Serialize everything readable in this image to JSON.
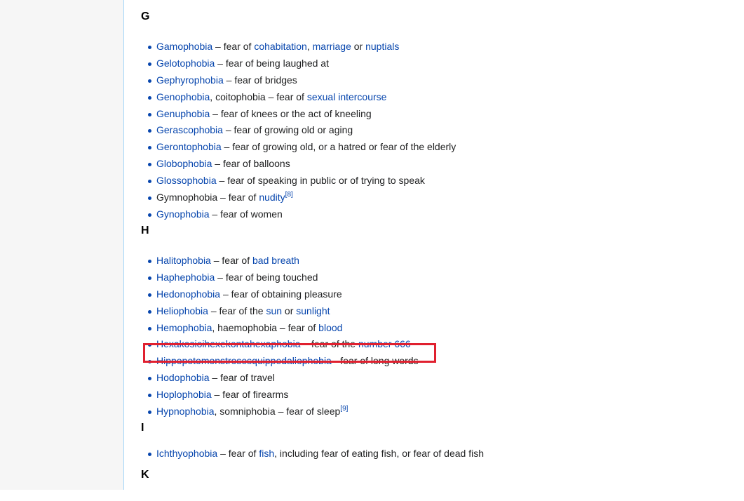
{
  "sections": {
    "g": {
      "heading": "G",
      "items": [
        [
          {
            "t": "Gamophobia",
            "link": true
          },
          {
            "t": " – fear of "
          },
          {
            "t": "cohabitation",
            "link": true
          },
          {
            "t": ", "
          },
          {
            "t": "marriage",
            "link": true
          },
          {
            "t": " or "
          },
          {
            "t": "nuptials",
            "link": true
          }
        ],
        [
          {
            "t": "Gelotophobia",
            "link": true
          },
          {
            "t": " – fear of being laughed at"
          }
        ],
        [
          {
            "t": "Gephyrophobia",
            "link": true
          },
          {
            "t": " – fear of bridges"
          }
        ],
        [
          {
            "t": "Genophobia",
            "link": true
          },
          {
            "t": ", coitophobia – fear of "
          },
          {
            "t": "sexual intercourse",
            "link": true
          }
        ],
        [
          {
            "t": "Genuphobia",
            "link": true
          },
          {
            "t": " – fear of knees or the act of kneeling"
          }
        ],
        [
          {
            "t": "Gerascophobia",
            "link": true
          },
          {
            "t": " – fear of growing old or aging"
          }
        ],
        [
          {
            "t": "Gerontophobia",
            "link": true
          },
          {
            "t": " – fear of growing old, or a hatred or fear of the elderly"
          }
        ],
        [
          {
            "t": "Globophobia",
            "link": true
          },
          {
            "t": " – fear of balloons"
          }
        ],
        [
          {
            "t": "Glossophobia",
            "link": true
          },
          {
            "t": " – fear of speaking in public or of trying to speak"
          }
        ],
        [
          {
            "t": "Gymnophobia – fear of "
          },
          {
            "t": "nudity",
            "link": true
          },
          {
            "t": "[8]",
            "sup": true
          }
        ],
        [
          {
            "t": "Gynophobia",
            "link": true
          },
          {
            "t": " – fear of women"
          }
        ]
      ]
    },
    "h": {
      "heading": "H",
      "items": [
        [
          {
            "t": "Halitophobia",
            "link": true
          },
          {
            "t": " – fear of "
          },
          {
            "t": "bad breath",
            "link": true
          }
        ],
        [
          {
            "t": "Haphephobia",
            "link": true
          },
          {
            "t": " – fear of being touched"
          }
        ],
        [
          {
            "t": "Hedonophobia",
            "link": true
          },
          {
            "t": " – fear of obtaining pleasure"
          }
        ],
        [
          {
            "t": "Heliophobia",
            "link": true
          },
          {
            "t": " – fear of the "
          },
          {
            "t": "sun",
            "link": true
          },
          {
            "t": " or "
          },
          {
            "t": "sunlight",
            "link": true
          }
        ],
        [
          {
            "t": "Hemophobia",
            "link": true
          },
          {
            "t": ", haemophobia – fear of "
          },
          {
            "t": "blood",
            "link": true
          }
        ],
        [
          {
            "t": "Hexakosioihexekontahexaphobia",
            "link": true
          },
          {
            "t": " – fear of the "
          },
          {
            "t": "number 666",
            "link": true
          }
        ],
        [
          {
            "t": "Hippopotomonstrosesquippedaliophobia",
            "link": true
          },
          {
            "t": " - fear of long words"
          }
        ],
        [
          {
            "t": "Hodophobia",
            "link": true
          },
          {
            "t": " – fear of travel"
          }
        ],
        [
          {
            "t": "Hoplophobia",
            "link": true
          },
          {
            "t": " – fear of firearms"
          }
        ],
        [
          {
            "t": "Hypnophobia",
            "link": true
          },
          {
            "t": ", somniphobia – fear of sleep"
          },
          {
            "t": "[9]",
            "sup": true
          }
        ]
      ]
    },
    "i": {
      "heading": "I",
      "items": [
        [
          {
            "t": "Ichthyophobia",
            "link": true
          },
          {
            "t": " – fear of "
          },
          {
            "t": "fish",
            "link": true
          },
          {
            "t": ", including fear of eating fish, or fear of dead fish"
          }
        ]
      ]
    },
    "k": {
      "heading": "K",
      "items": []
    }
  },
  "highlight": {
    "section": "h",
    "item_index": 6,
    "color": "#e0202f"
  },
  "colors": {
    "link": "#0645ad",
    "text": "#202122",
    "sidebar_bg": "#f6f6f6",
    "content_border": "#a7d7f9"
  }
}
